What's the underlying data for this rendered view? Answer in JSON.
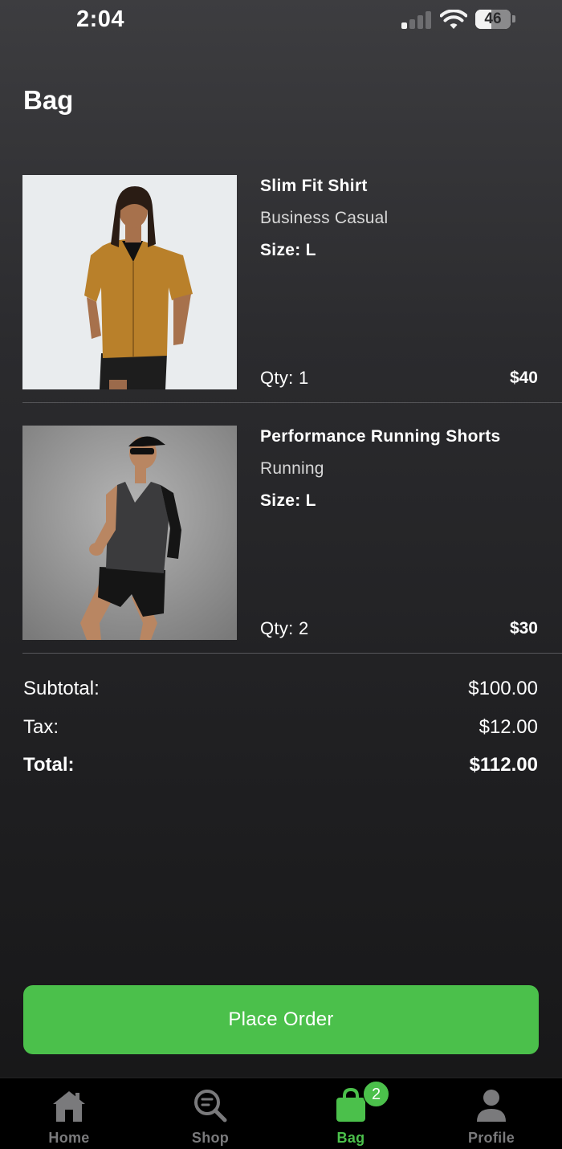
{
  "status_bar": {
    "time": "2:04",
    "battery_level": "46",
    "battery_fraction": 0.46
  },
  "page": {
    "title": "Bag"
  },
  "bag_items": [
    {
      "name": "Slim Fit Shirt",
      "category": "Business Casual",
      "size": "Size: L",
      "qty": "Qty: 1",
      "price": "$40"
    },
    {
      "name": "Performance Running Shorts",
      "category": "Running",
      "size": "Size: L",
      "qty": "Qty: 2",
      "price": "$30"
    }
  ],
  "totals": {
    "subtotal_label": "Subtotal:",
    "subtotal_value": "$100.00",
    "tax_label": "Tax:",
    "tax_value": "$12.00",
    "total_label": "Total:",
    "total_value": "$112.00"
  },
  "actions": {
    "place_order_label": "Place Order"
  },
  "tab_bar": {
    "items": [
      {
        "label": "Home",
        "icon": "home-icon"
      },
      {
        "label": "Shop",
        "icon": "search-icon"
      },
      {
        "label": "Bag",
        "icon": "bag-icon",
        "badge": "2",
        "active": true
      },
      {
        "label": "Profile",
        "icon": "person-icon"
      }
    ]
  },
  "colors": {
    "accent": "#4bc04b",
    "inactive_tab": "#7a7a7c",
    "background_top": "#3d3d40",
    "background_bottom": "#161617"
  }
}
